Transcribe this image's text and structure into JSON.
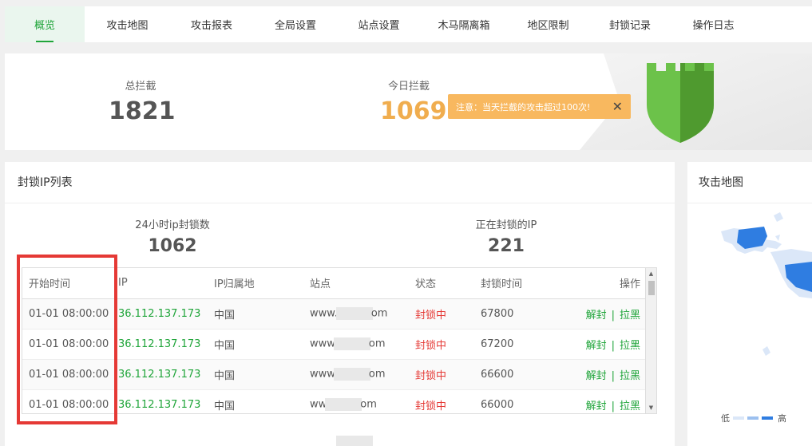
{
  "tabs": [
    {
      "label": "概览",
      "active": true
    },
    {
      "label": "攻击地图"
    },
    {
      "label": "攻击报表"
    },
    {
      "label": "全局设置"
    },
    {
      "label": "站点设置"
    },
    {
      "label": "木马隔离箱"
    },
    {
      "label": "地区限制"
    },
    {
      "label": "封锁记录"
    },
    {
      "label": "操作日志"
    }
  ],
  "summary": {
    "total_label": "总拦截",
    "total_value": "1821",
    "today_label": "今日拦截",
    "today_value": "1069"
  },
  "toast": {
    "message": "注意：当天拦截的攻击超过100次!",
    "close": "✕"
  },
  "blocked_panel": {
    "title": "封锁IP列表",
    "stat_24h_label": "24小时ip封锁数",
    "stat_24h_value": "1062",
    "stat_active_label": "正在封锁的IP",
    "stat_active_value": "221",
    "columns": {
      "start": "开始时间",
      "ip": "IP",
      "location": "IP归属地",
      "site": "站点",
      "status": "状态",
      "block_time": "封锁时间",
      "ops": "操作"
    },
    "rows": [
      {
        "start": "01-01 08:00:00",
        "ip": "36.112.137.173",
        "location": "中国",
        "site_prefix": "www.",
        "site_suffix": "om",
        "status": "封锁中",
        "block_time": "67800",
        "unblock": "解封",
        "sep": "|",
        "blacklist": "拉黑"
      },
      {
        "start": "01-01 08:00:00",
        "ip": "36.112.137.173",
        "location": "中国",
        "site_prefix": "www",
        "site_suffix": "om",
        "status": "封锁中",
        "block_time": "67200",
        "unblock": "解封",
        "sep": "|",
        "blacklist": "拉黑"
      },
      {
        "start": "01-01 08:00:00",
        "ip": "36.112.137.173",
        "location": "中国",
        "site_prefix": "www",
        "site_suffix": "om",
        "status": "封锁中",
        "block_time": "66600",
        "unblock": "解封",
        "sep": "|",
        "blacklist": "拉黑"
      },
      {
        "start": "01-01 08:00:00",
        "ip": "36.112.137.173",
        "location": "中国",
        "site_prefix": "ww",
        "site_suffix": "om",
        "status": "封锁中",
        "block_time": "66000",
        "unblock": "解封",
        "sep": "|",
        "blacklist": "拉黑"
      }
    ]
  },
  "map_panel": {
    "title": "攻击地图",
    "legend_low": "低",
    "legend_high": "高",
    "legend_colors": [
      "#dbe7f8",
      "#9cc0ef",
      "#2f7de1"
    ]
  },
  "colors": {
    "accent": "#20a53a",
    "warning": "#f0ad4e",
    "danger": "#e53935",
    "map_high": "#2f7de1"
  }
}
